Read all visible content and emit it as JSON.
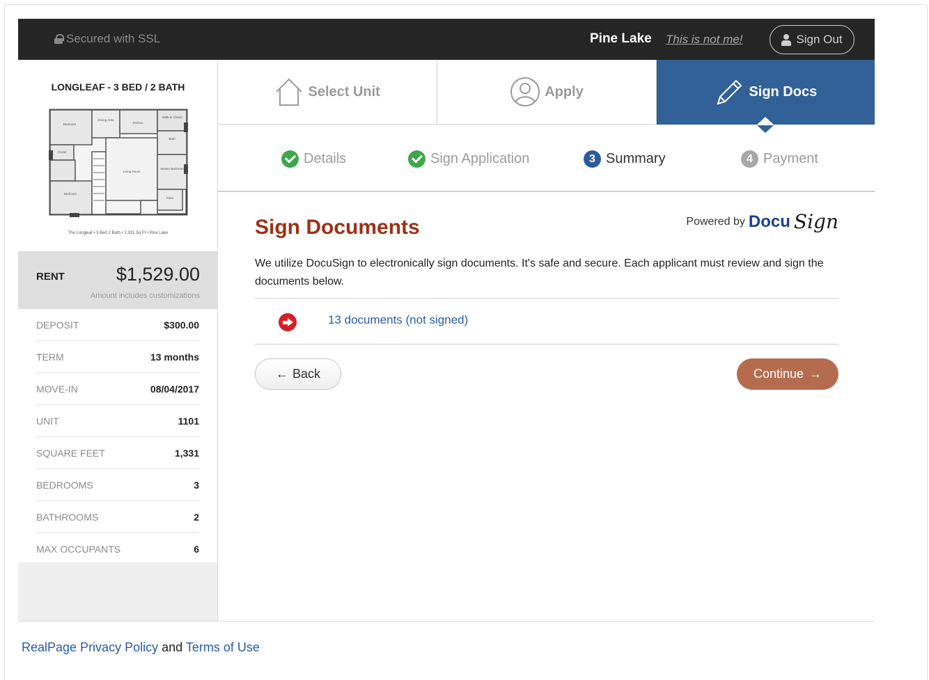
{
  "topbar": {
    "ssl_text": "Secured with SSL",
    "username": "Pine Lake",
    "not_me": "This is not me!",
    "sign_out": "Sign Out"
  },
  "sidebar": {
    "unit_title": "LONGLEAF - 3 BED / 2 BATH",
    "floorplan_caption": "The Longleaf • 3 Bed 2 Bath • 1,331 Sq Ft • Pine Lake",
    "floorplan_rooms": [
      "Bedroom",
      "Dining Area",
      "Kitchen",
      "Walk-in Closet",
      "Bath",
      "Closet",
      "Living Room",
      "Master Bedroom",
      "Bedroom",
      "Patio"
    ],
    "rent_label": "RENT",
    "rent_value": "$1,529.00",
    "rent_note": "Amount includes customizations",
    "details": [
      {
        "label": "DEPOSIT",
        "value": "$300.00"
      },
      {
        "label": "TERM",
        "value": "13 months"
      },
      {
        "label": "MOVE-IN",
        "value": "08/04/2017"
      },
      {
        "label": "UNIT",
        "value": "1101"
      },
      {
        "label": "SQUARE FEET",
        "value": "1,331"
      },
      {
        "label": "BEDROOMS",
        "value": "3"
      },
      {
        "label": "BATHROOMS",
        "value": "2"
      },
      {
        "label": "MAX OCCUPANTS",
        "value": "6"
      }
    ]
  },
  "tabs": [
    {
      "label": "Select Unit",
      "icon": "house-icon"
    },
    {
      "label": "Apply",
      "icon": "user-circle-icon"
    },
    {
      "label": "Sign Docs",
      "icon": "pencil-icon"
    }
  ],
  "steps": [
    {
      "label": "Details",
      "state": "done"
    },
    {
      "label": "Sign Application",
      "state": "done"
    },
    {
      "label": "Summary",
      "number": "3",
      "state": "current"
    },
    {
      "label": "Payment",
      "number": "4",
      "state": "upcoming"
    }
  ],
  "main": {
    "title": "Sign Documents",
    "powered_by": "Powered by",
    "brand_docu": "Docu",
    "brand_sign": "Sign",
    "intro": "We utilize DocuSign to electronically sign documents. It's safe and secure. Each applicant must review and sign the documents below.",
    "documents_link": "13 documents (not signed)",
    "back_label": "Back",
    "back_arrow": "←",
    "continue_label": "Continue",
    "continue_arrow": "→"
  },
  "footer": {
    "privacy": "RealPage Privacy Policy",
    "and": "and",
    "terms": "Terms of Use"
  },
  "colors": {
    "topbar": "#262626",
    "active_tab": "#316197",
    "title": "#9c3116",
    "continue": "#b56c4e",
    "link": "#2a5ba8",
    "check": "#3fa64b",
    "alert": "#d31f26"
  }
}
